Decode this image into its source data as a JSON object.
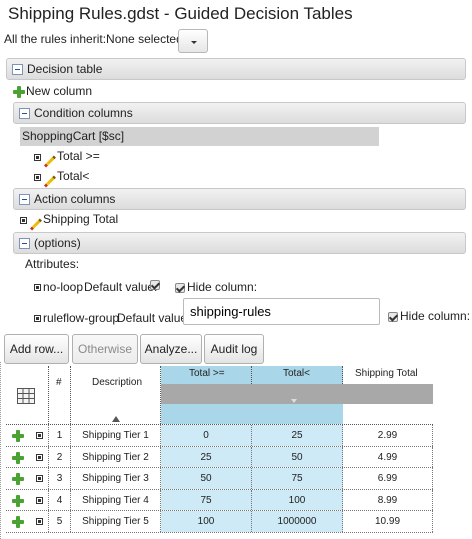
{
  "window": {
    "title": "Shipping Rules.gdst - Guided Decision Tables"
  },
  "inherit": {
    "label": "All the rules inherit:",
    "value": "None selected"
  },
  "sections": {
    "decision_table": "Decision table",
    "new_column": "New column",
    "condition_columns": "Condition columns",
    "pattern": "ShoppingCart [$sc]",
    "conditions": [
      "Total >=",
      "Total<"
    ],
    "action_columns": "Action columns",
    "actions": [
      "Shipping Total"
    ],
    "options": "(options)"
  },
  "attributes": {
    "label": "Attributes:",
    "no_loop": {
      "name": "no-loop",
      "default_label": "Default value:",
      "hide_label": "Hide column:",
      "default_checked": true,
      "hide_checked": true
    },
    "ruleflow_group": {
      "name": "ruleflow-group",
      "default_label": "Default value:",
      "value": "shipping-rules",
      "hide_label": "Hide column:",
      "hide_checked": true
    }
  },
  "toolbar": {
    "add_row": "Add row...",
    "otherwise": "Otherwise",
    "analyze": "Analyze...",
    "audit_log": "Audit log"
  },
  "table": {
    "headers": {
      "num": "#",
      "description": "Description",
      "total_gte": "Total >=",
      "total_lt": "Total<",
      "shipping_total": "Shipping Total"
    },
    "rows": [
      {
        "num": "1",
        "description": "Shipping Tier 1",
        "total_gte": "0",
        "total_lt": "25",
        "shipping_total": "2.99"
      },
      {
        "num": "2",
        "description": "Shipping Tier 2",
        "total_gte": "25",
        "total_lt": "50",
        "shipping_total": "4.99"
      },
      {
        "num": "3",
        "description": "Shipping Tier 3",
        "total_gte": "50",
        "total_lt": "75",
        "shipping_total": "6.99"
      },
      {
        "num": "4",
        "description": "Shipping Tier 4",
        "total_gte": "75",
        "total_lt": "100",
        "shipping_total": "8.99"
      },
      {
        "num": "5",
        "description": "Shipping Tier 5",
        "total_gte": "100",
        "total_lt": "1000000",
        "shipping_total": "10.99"
      }
    ]
  },
  "colors": {
    "highlight_column": "#a9d6e8",
    "section_bar": "#e6e6e6",
    "add_icon": "#4aa233"
  }
}
